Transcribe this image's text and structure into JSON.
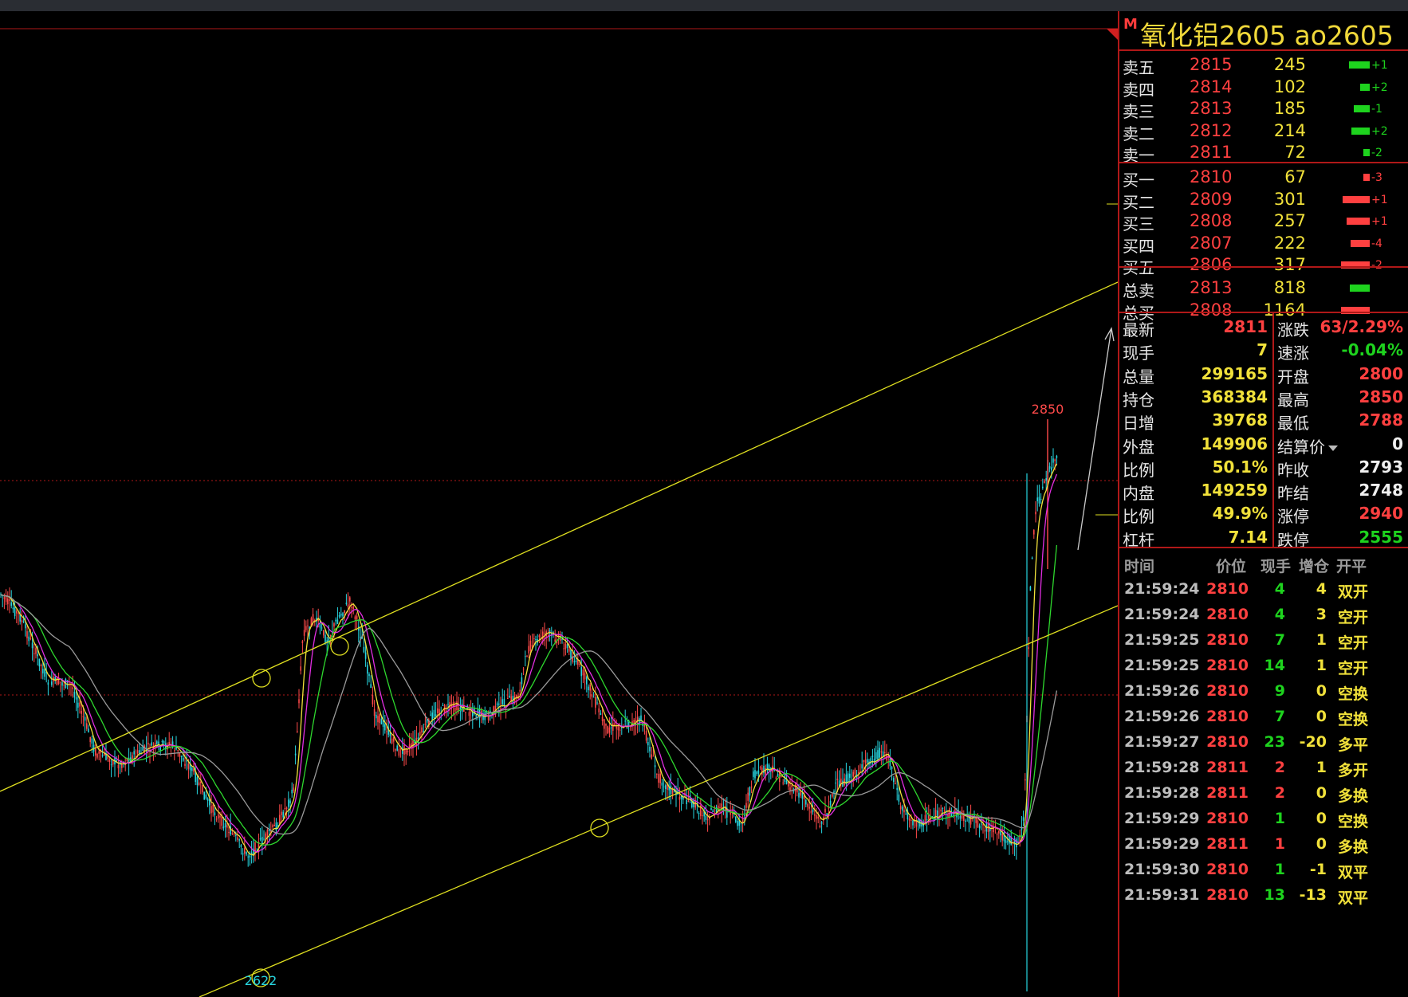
{
  "title": {
    "badge": "M",
    "name": "氧化铝2605  ao2605"
  },
  "colors": {
    "up": "#ff4040",
    "down": "#1ed31e",
    "yellow": "#f1e13a",
    "white": "#f0f0f0",
    "cyan": "#27d6e0",
    "frame": "#b01818"
  },
  "chart": {
    "high_label": "2850",
    "low_label": "2622"
  },
  "asks": [
    {
      "label": "卖五",
      "price": "2815",
      "vol": "245",
      "chg": "+1",
      "bar": 0.62
    },
    {
      "label": "卖四",
      "price": "2814",
      "vol": "102",
      "chg": "+2",
      "bar": 0.28
    },
    {
      "label": "卖三",
      "price": "2813",
      "vol": "185",
      "chg": "-1",
      "bar": 0.48
    },
    {
      "label": "卖二",
      "price": "2812",
      "vol": "214",
      "chg": "+2",
      "bar": 0.55
    },
    {
      "label": "卖一",
      "price": "2811",
      "vol": "72",
      "chg": "-2",
      "bar": 0.2
    }
  ],
  "bids": [
    {
      "label": "买一",
      "price": "2810",
      "vol": "67",
      "chg": "-3",
      "bar": 0.18
    },
    {
      "label": "买二",
      "price": "2809",
      "vol": "301",
      "chg": "+1",
      "bar": 0.8
    },
    {
      "label": "买三",
      "price": "2808",
      "vol": "257",
      "chg": "+1",
      "bar": 0.68
    },
    {
      "label": "买四",
      "price": "2807",
      "vol": "222",
      "chg": "-4",
      "bar": 0.58
    },
    {
      "label": "买五",
      "price": "2806",
      "vol": "317",
      "chg": "-2",
      "bar": 0.85
    }
  ],
  "totals": [
    {
      "label": "总卖",
      "price": "2813",
      "vol": "818",
      "side": "sell",
      "bar": 0.6
    },
    {
      "label": "总买",
      "price": "2808",
      "vol": "1164",
      "side": "buy",
      "bar": 0.85
    }
  ],
  "stats_left": [
    {
      "label": "最新",
      "value": "2811",
      "color": "up"
    },
    {
      "label": "现手",
      "value": "7",
      "color": "yellow"
    },
    {
      "label": "总量",
      "value": "299165",
      "color": "yellow"
    },
    {
      "label": "持仓",
      "value": "368384",
      "color": "yellow"
    },
    {
      "label": "日增",
      "value": "39768",
      "color": "yellow"
    },
    {
      "label": "外盘",
      "value": "149906",
      "color": "yellow"
    },
    {
      "label": "比例",
      "value": "50.1%",
      "color": "yellow"
    },
    {
      "label": "内盘",
      "value": "149259",
      "color": "yellow"
    },
    {
      "label": "比例",
      "value": "49.9%",
      "color": "yellow"
    },
    {
      "label": "杠杆",
      "value": "7.14",
      "color": "yellow"
    }
  ],
  "stats_right": [
    {
      "label": "涨跌",
      "value": "63/2.29%",
      "color": "up"
    },
    {
      "label": "速涨",
      "value": "-0.04%",
      "color": "down"
    },
    {
      "label": "开盘",
      "value": "2800",
      "color": "up"
    },
    {
      "label": "最高",
      "value": "2850",
      "color": "up"
    },
    {
      "label": "最低",
      "value": "2788",
      "color": "up"
    },
    {
      "label": "结算价",
      "value": "0",
      "color": "white",
      "dropdown": true
    },
    {
      "label": "昨收",
      "value": "2793",
      "color": "white"
    },
    {
      "label": "昨结",
      "value": "2748",
      "color": "white"
    },
    {
      "label": "涨停",
      "value": "2940",
      "color": "up"
    },
    {
      "label": "跌停",
      "value": "2555",
      "color": "down"
    }
  ],
  "ticks_header": {
    "time": "时间",
    "price": "价位",
    "qty": "现手",
    "oi": "增仓",
    "type": "开平"
  },
  "ticks": [
    {
      "time": "21:59:24",
      "price": "2810",
      "qty": "4",
      "oi": "4",
      "type": "双开",
      "pc": "up",
      "qc": "down",
      "oc": "yellow",
      "tc": "yellow"
    },
    {
      "time": "21:59:24",
      "price": "2810",
      "qty": "4",
      "oi": "3",
      "type": "空开",
      "pc": "up",
      "qc": "down",
      "oc": "yellow",
      "tc": "yellow"
    },
    {
      "time": "21:59:25",
      "price": "2810",
      "qty": "7",
      "oi": "1",
      "type": "空开",
      "pc": "up",
      "qc": "down",
      "oc": "yellow",
      "tc": "yellow"
    },
    {
      "time": "21:59:25",
      "price": "2810",
      "qty": "14",
      "oi": "1",
      "type": "空开",
      "pc": "up",
      "qc": "down",
      "oc": "yellow",
      "tc": "yellow"
    },
    {
      "time": "21:59:26",
      "price": "2810",
      "qty": "9",
      "oi": "0",
      "type": "空换",
      "pc": "up",
      "qc": "down",
      "oc": "yellow",
      "tc": "yellow"
    },
    {
      "time": "21:59:26",
      "price": "2810",
      "qty": "7",
      "oi": "0",
      "type": "空换",
      "pc": "up",
      "qc": "down",
      "oc": "yellow",
      "tc": "yellow"
    },
    {
      "time": "21:59:27",
      "price": "2810",
      "qty": "23",
      "oi": "-20",
      "type": "多平",
      "pc": "up",
      "qc": "down",
      "oc": "yellow",
      "tc": "yellow"
    },
    {
      "time": "21:59:28",
      "price": "2811",
      "qty": "2",
      "oi": "1",
      "type": "多开",
      "pc": "up",
      "qc": "up",
      "oc": "yellow",
      "tc": "yellow"
    },
    {
      "time": "21:59:28",
      "price": "2811",
      "qty": "2",
      "oi": "0",
      "type": "多换",
      "pc": "up",
      "qc": "up",
      "oc": "yellow",
      "tc": "yellow"
    },
    {
      "time": "21:59:29",
      "price": "2810",
      "qty": "1",
      "oi": "0",
      "type": "空换",
      "pc": "up",
      "qc": "down",
      "oc": "yellow",
      "tc": "yellow"
    },
    {
      "time": "21:59:29",
      "price": "2811",
      "qty": "1",
      "oi": "0",
      "type": "多换",
      "pc": "up",
      "qc": "up",
      "oc": "yellow",
      "tc": "yellow"
    },
    {
      "time": "21:59:30",
      "price": "2810",
      "qty": "1",
      "oi": "-1",
      "type": "双平",
      "pc": "up",
      "qc": "down",
      "oc": "yellow",
      "tc": "yellow"
    },
    {
      "time": "21:59:31",
      "price": "2810",
      "qty": "13",
      "oi": "-13",
      "type": "双平",
      "pc": "up",
      "qc": "down",
      "oc": "yellow",
      "tc": "yellow"
    }
  ]
}
